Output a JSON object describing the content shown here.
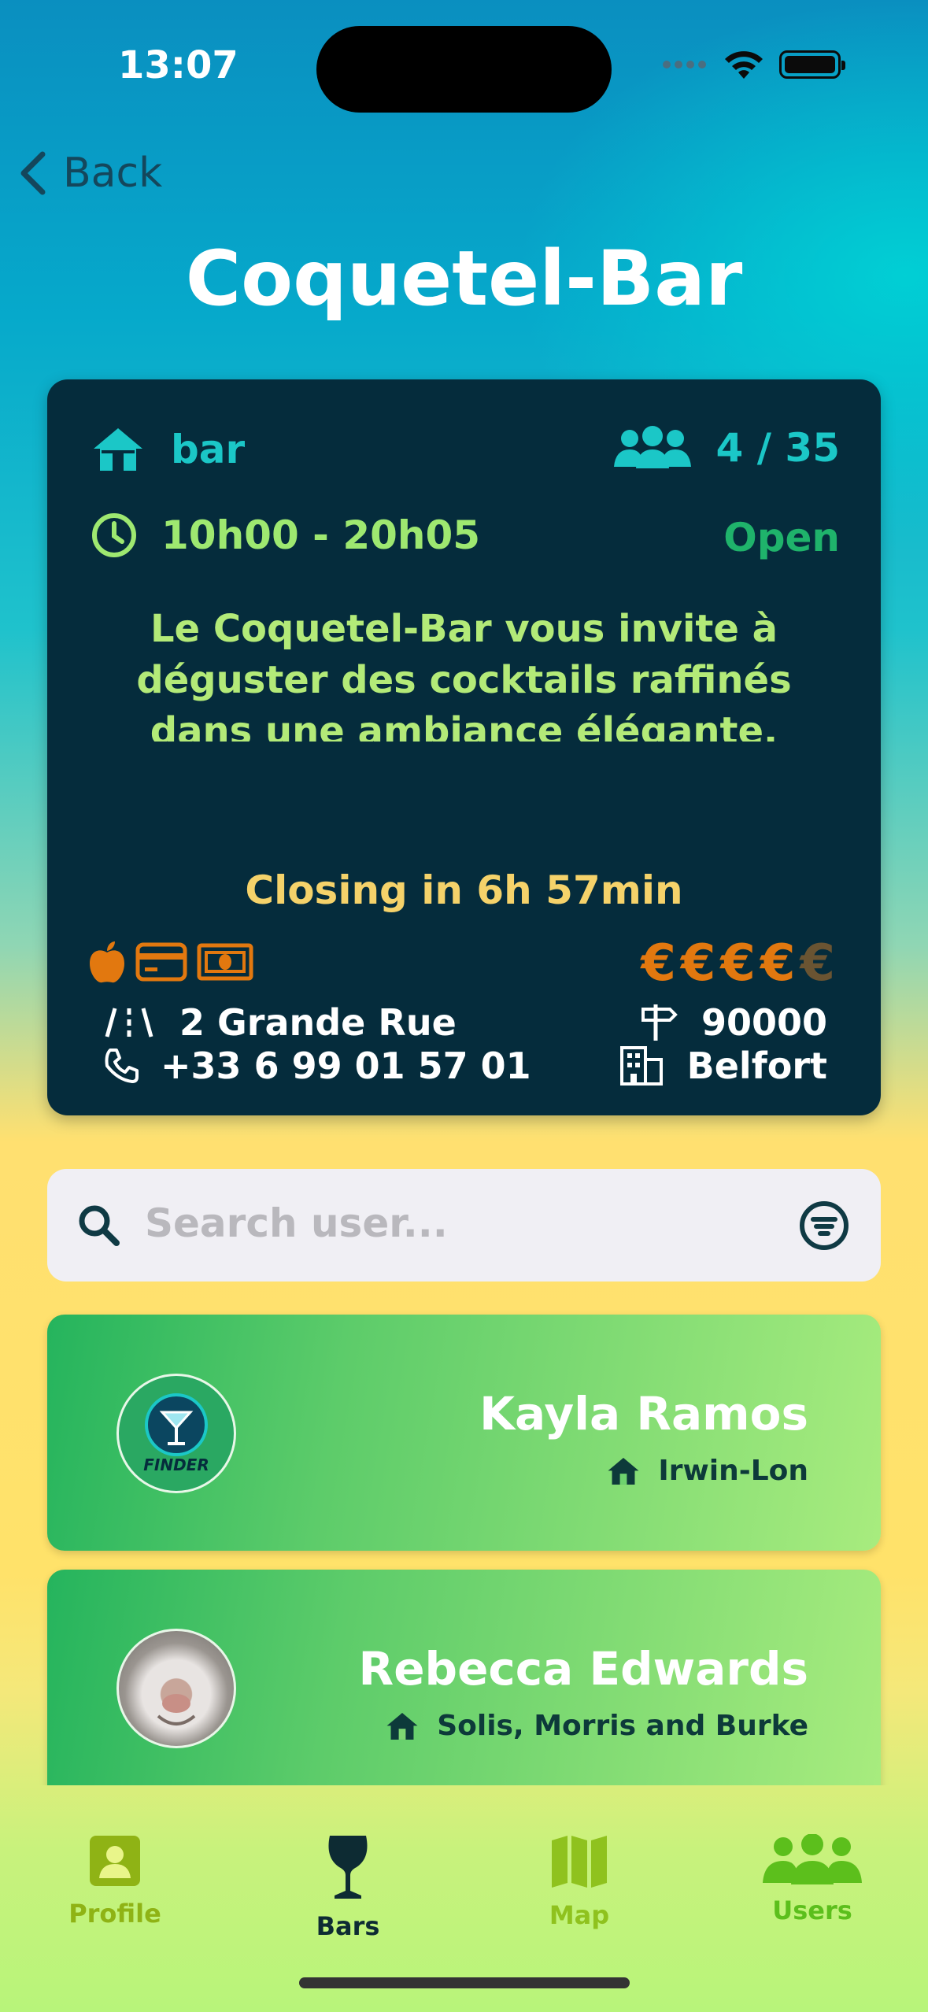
{
  "status": {
    "time": "13:07"
  },
  "nav": {
    "back_label": "Back",
    "title": "Coquetel-Bar"
  },
  "bar_card": {
    "type": "bar",
    "capacity": "4 / 35",
    "hours": "10h00 - 20h05",
    "state": "Open",
    "description": "Le Coquetel-Bar vous invite à déguster des cocktails raffinés dans une ambiance élégante. Notre équipe de mixologues talentueux vous propose des créations uniques",
    "closing": "Closing in 6h 57min",
    "payment_icons": [
      "apple-icon",
      "credit-card-icon",
      "cash-icon"
    ],
    "price_level": 4,
    "price_max": 5,
    "price_symbol": "€",
    "street": "2 Grande Rue",
    "phone": "+33 6 99 01 57 01",
    "postal_code": "90000",
    "city": "Belfort"
  },
  "search": {
    "placeholder": "Search user..."
  },
  "users": [
    {
      "name": "Kayla Ramos",
      "bar": "Irwin-Lon",
      "avatar": "finder-logo"
    },
    {
      "name": "Rebecca Edwards",
      "bar": "Solis, Morris and Burke",
      "avatar": "cat-photo"
    }
  ],
  "tabs": [
    {
      "label": "Profile",
      "icon": "person-icon",
      "color": "#8fb315"
    },
    {
      "label": "Bars",
      "icon": "wine-glass-icon",
      "color": "#0d2b33",
      "active": true
    },
    {
      "label": "Map",
      "icon": "map-icon",
      "color": "#8fc21e"
    },
    {
      "label": "Users",
      "icon": "users-icon",
      "color": "#5cbf1c"
    }
  ],
  "colors": {
    "card_bg": "#052c3c",
    "teal": "#1bc7c7",
    "open_green": "#1fb36b",
    "closing_yellow": "#f5d26a",
    "accent_orange": "#e2780f"
  }
}
